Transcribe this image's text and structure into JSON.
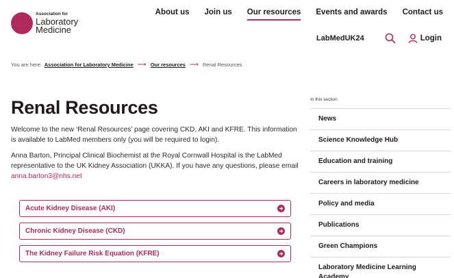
{
  "logo": {
    "small": "Association for",
    "line1": "Laboratory",
    "line2": "Medicine"
  },
  "topnav": [
    "About us",
    "Join us",
    "Our resources",
    "Events and awards",
    "Contact us"
  ],
  "utility": {
    "event": "LabMedUK24",
    "login": "Login"
  },
  "breadcrumb": {
    "lead": "You are here:",
    "crumbs": [
      "Association for Laboratory Medicine",
      "Our resources",
      "Renal Resources"
    ]
  },
  "main": {
    "title": "Renal Resources",
    "para1": "Welcome to the new ‘Renal Resources’ page covering CKD, AKI and KFRE. This information is available to LabMed members only (you will be required to login).",
    "para2": "Anna Barton, Principal Clinical Biochemist at the Royal Cornwall Hospital is the LabMed representative to the UK Kidney Association (UKKA).  If you have any questions, please email",
    "email": "anna.barton3@nhs.net"
  },
  "accordions": [
    "Acute Kidney Disease (AKI)",
    "Chronic Kidney Disease (CKD)",
    "The Kidney Failure Risk Equation (KFRE)"
  ],
  "sidebar": {
    "heading": "In this section",
    "items": [
      "News",
      "Science Knowledge Hub",
      "Education and training",
      "Careers in laboratory medicine",
      "Policy and media",
      "Publications",
      "Green Champions",
      "Laboratory Medicine Learning Academy"
    ]
  },
  "colors": {
    "accent": "#b02a5c",
    "text": "#1f1a1c"
  },
  "icons": {
    "search": "search-icon",
    "login": "user-icon",
    "accordion": "arrow-circle-icon",
    "breadcrumb_sep": "arrow-right-icon"
  }
}
